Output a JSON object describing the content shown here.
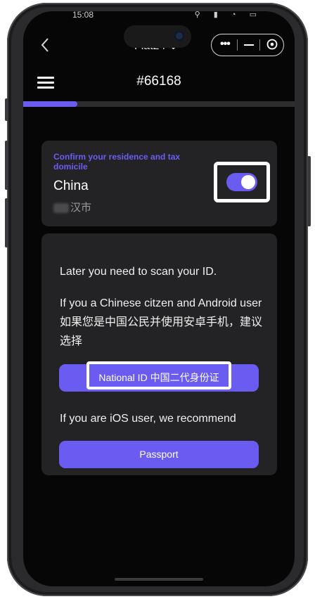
{
  "status_bar": {
    "time": "15:08",
    "icons": "⚲ ▮ ◔ ▭"
  },
  "top_bar": {
    "title": "Flat24 ⌄"
  },
  "header": {
    "case_number": "#66168"
  },
  "progress": {
    "value": 0.2,
    "color": "#6a5cf0"
  },
  "residence": {
    "confirm_label": "Confirm your residence and tax domicile",
    "country": "China",
    "city_suffix": "汉市",
    "toggle_on": true
  },
  "id_card": {
    "scan_note": "Later you need to scan your ID.",
    "android_text": "If you a Chinese citzen and Android user 如果您是中国公民并使用安卓手机，建议选择",
    "national_id_button": "National ID 中国二代身份证",
    "ios_text": "If you are iOS user, we recommend",
    "passport_button": "Passport"
  },
  "colors": {
    "accent": "#6a5cf0",
    "background": "#060606",
    "card": "#232325"
  },
  "icons": [
    "back-arrow-icon",
    "more-dots-icon",
    "minimize-icon",
    "close-circle-icon",
    "hamburger-menu-icon",
    "toggle-switch"
  ]
}
